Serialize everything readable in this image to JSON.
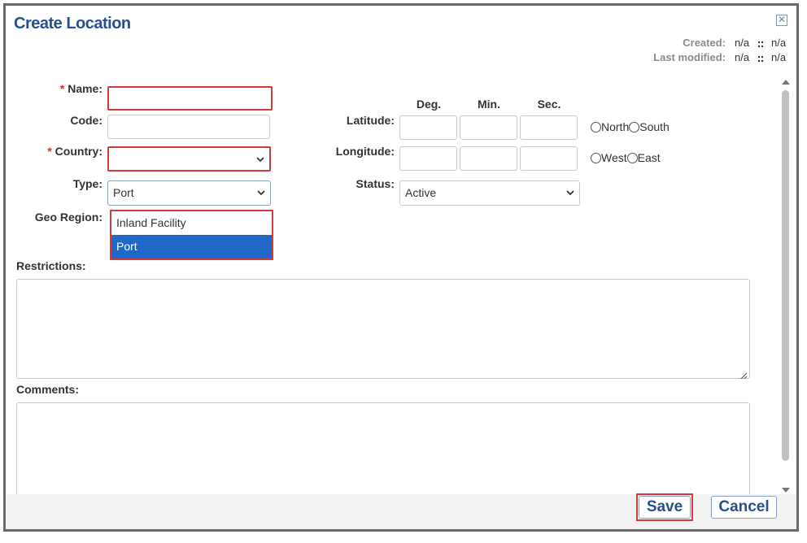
{
  "dialog": {
    "title": "Create Location",
    "close_glyph": "✕"
  },
  "meta": {
    "created_label": "Created:",
    "created_value1": "n/a",
    "created_value2": "n/a",
    "modified_label": "Last modified:",
    "modified_value1": "n/a",
    "modified_value2": "n/a"
  },
  "form": {
    "required_mark": "*",
    "name_label": "Name:",
    "name_value": "",
    "code_label": "Code:",
    "code_value": "",
    "country_label": "Country:",
    "country_value": "",
    "type_label": "Type:",
    "type_value": "Port",
    "geo_region_label": "Geo Region:",
    "restrictions_label": "Restrictions:",
    "comments_label": "Comments:"
  },
  "type_dropdown": {
    "options": [
      "Inland Facility",
      "Port"
    ],
    "selected": "Port"
  },
  "coordinates": {
    "deg_header": "Deg.",
    "min_header": "Min.",
    "sec_header": "Sec.",
    "latitude_label": "Latitude:",
    "longitude_label": "Longitude:",
    "north_label": "North",
    "south_label": "South",
    "west_label": "West",
    "east_label": "East"
  },
  "status": {
    "label": "Status:",
    "value": "Active"
  },
  "buttons": {
    "save": "Save",
    "cancel": "Cancel"
  },
  "colors": {
    "title_blue": "#27508f",
    "error_red": "#d23b3b",
    "selected_blue": "#1f68c7"
  }
}
